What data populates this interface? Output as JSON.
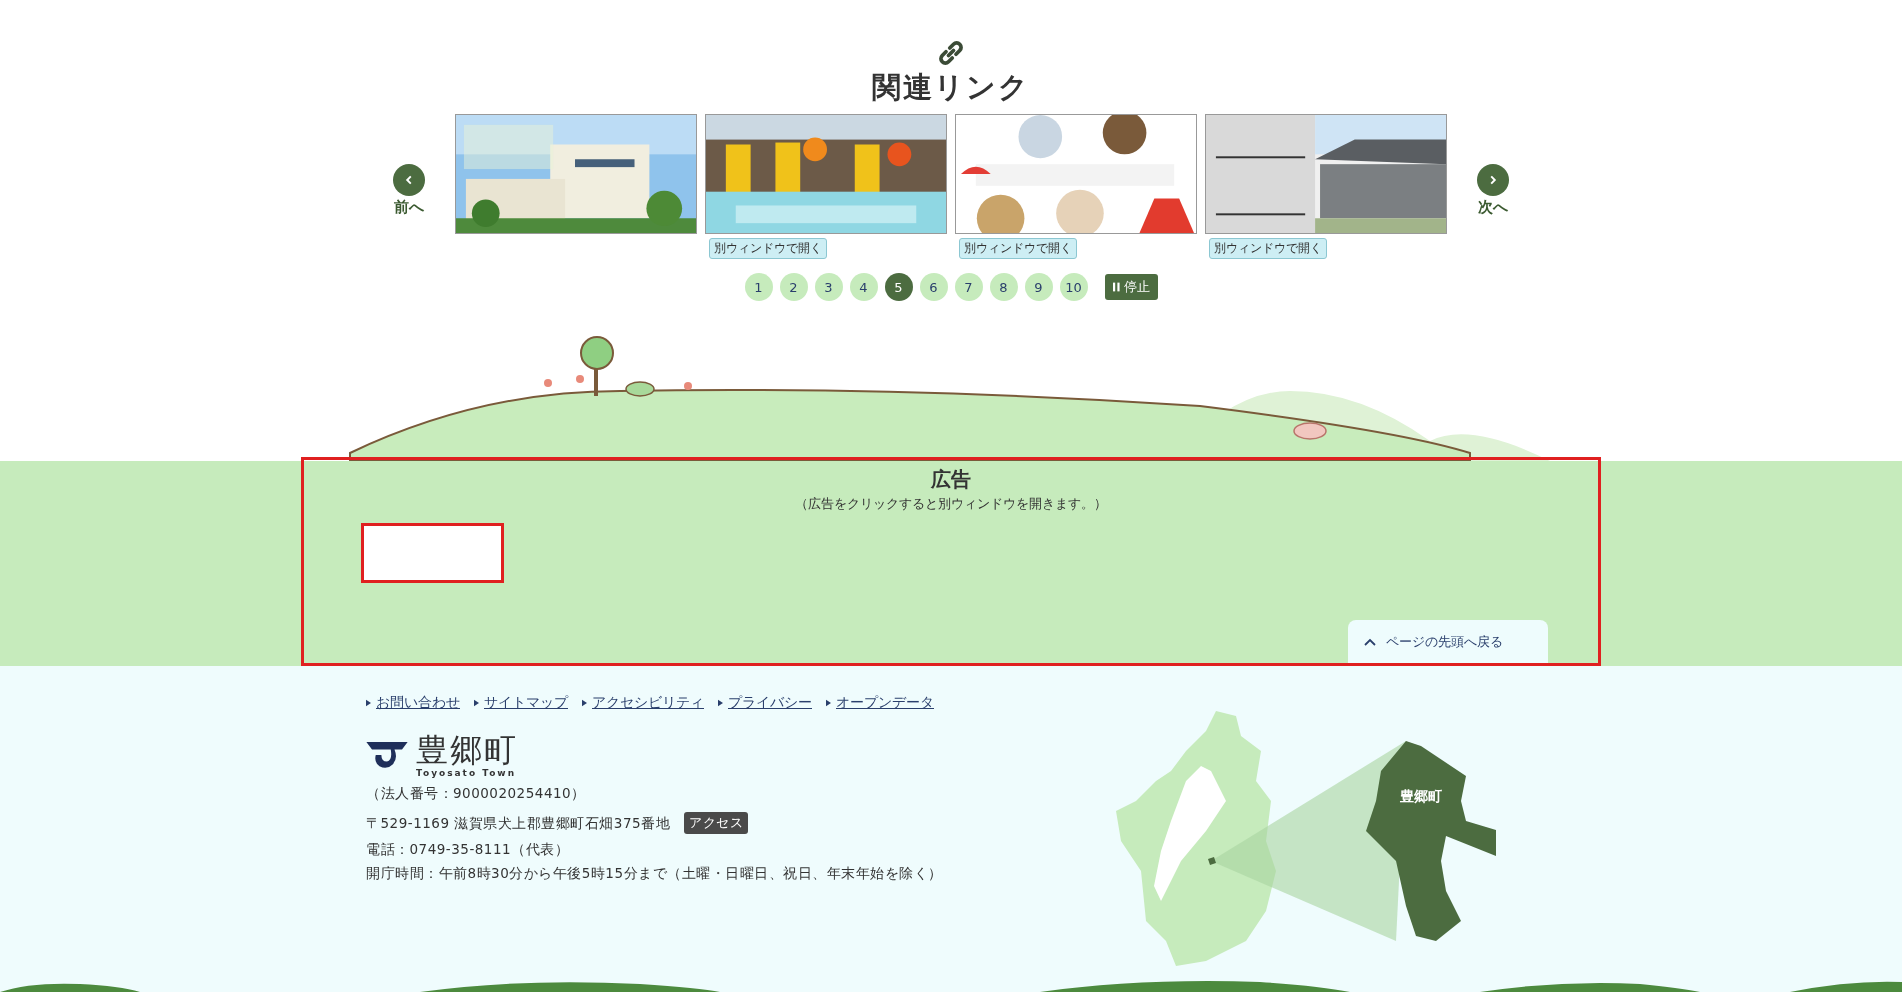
{
  "related_links": {
    "title": "関連リンク",
    "prev": "前へ",
    "next": "次へ",
    "banners": [
      {
        "kind": "picture"
      },
      {
        "kind": "picture",
        "badge": "別ウィンドウで開く"
      },
      {
        "kind": "picture",
        "badge": "別ウィンドウで開く"
      },
      {
        "kind": "picture",
        "badge": "別ウィンドウで開く"
      }
    ],
    "pages": [
      {
        "label": "1",
        "selected": false
      },
      {
        "label": "2",
        "selected": false
      },
      {
        "label": "3",
        "selected": false
      },
      {
        "label": "4",
        "selected": false
      },
      {
        "label": "5",
        "selected": true
      },
      {
        "label": "6",
        "selected": false
      },
      {
        "label": "7",
        "selected": false
      },
      {
        "label": "8",
        "selected": false
      },
      {
        "label": "9",
        "selected": false
      },
      {
        "label": "10",
        "selected": false
      }
    ],
    "stop_button": "停止"
  },
  "ads": {
    "title": "広告",
    "note": "（広告をクリックすると別ウィンドウを開きます。）",
    "back_to_top": "ページの先頭へ戻る"
  },
  "footer": {
    "links": [
      "お問い合わせ",
      "サイトマップ",
      "アクセシビリティ",
      "プライバシー",
      "オープンデータ"
    ],
    "logo_name": "豊郷町",
    "logo_sub": "Toyosato Town",
    "corporate_number": "（法人番号：9000020254410）",
    "address": "〒529-1169 滋賀県犬上郡豊郷町石畑375番地",
    "access_button": "アクセス",
    "phone": "電話：0749-35-8111（代表）",
    "hours": "開庁時間：午前8時30分から午後5時15分まで（土曜・日曜日、祝日、年末年始を除く）",
    "map_label": "豊郷町"
  }
}
